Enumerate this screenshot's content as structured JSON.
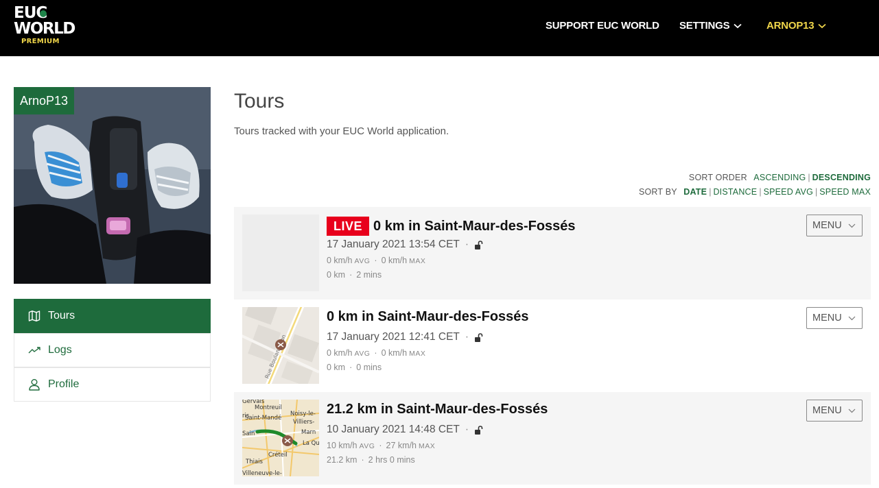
{
  "header": {
    "logo": {
      "line1": "EUC",
      "line2": "WORLD",
      "line3": "PREMIUM"
    },
    "nav": {
      "support": "SUPPORT EUC WORLD",
      "settings": "SETTINGS",
      "user": "ARNOP13"
    }
  },
  "sidebar": {
    "username": "ArnoP13",
    "items": [
      {
        "label": "Tours",
        "icon": "map-icon",
        "active": true
      },
      {
        "label": "Logs",
        "icon": "chart-line-icon",
        "active": false
      },
      {
        "label": "Profile",
        "icon": "user-icon",
        "active": false
      }
    ]
  },
  "main": {
    "title": "Tours",
    "subtitle": "Tours tracked with your EUC World application.",
    "sort_order": {
      "label": "SORT ORDER",
      "ascending": "ASCENDING",
      "descending": "DESCENDING",
      "selected": "DESCENDING"
    },
    "sort_by": {
      "label": "SORT BY",
      "date": "DATE",
      "distance": "DISTANCE",
      "speed_avg": "SPEED AVG",
      "speed_max": "SPEED MAX",
      "selected": "DATE"
    },
    "tours": [
      {
        "live": "LIVE",
        "title": "0 km in Saint-Maur-des-Fossés",
        "date": "17 January 2021 13:54 CET",
        "speed_avg": "0 km/h",
        "avg_label": "AVG",
        "speed_max": "0 km/h",
        "max_label": "MAX",
        "distance": "0 km",
        "duration": "2 mins",
        "menu": "MENU"
      },
      {
        "title": "0 km in Saint-Maur-des-Fossés",
        "date": "17 January 2021 12:41 CET",
        "speed_avg": "0 km/h",
        "avg_label": "AVG",
        "speed_max": "0 km/h",
        "max_label": "MAX",
        "distance": "0 km",
        "duration": "0 mins",
        "menu": "MENU",
        "map_label": "Rue Boulangeron"
      },
      {
        "title": "21.2 km in Saint-Maur-des-Fossés",
        "date": "10 January 2021 14:48 CET",
        "speed_avg": "10 km/h",
        "avg_label": "AVG",
        "speed_max": "27 km/h",
        "max_label": "MAX",
        "distance": "21.2 km",
        "duration": "2 hrs 0 mins",
        "menu": "MENU",
        "map_labels": [
          "Gervais",
          "Montreuil",
          "ris",
          "Saint-Mandé",
          "Noisy-le-",
          "Villiers-",
          "Sain",
          "Marn",
          "La Qu",
          "Créteil",
          "Thiais",
          "Villeneuve-le-"
        ]
      }
    ]
  },
  "colors": {
    "brand_green": "#1e6b3c",
    "live_red": "#e8001c",
    "user_yellow": "#f0d64a"
  }
}
